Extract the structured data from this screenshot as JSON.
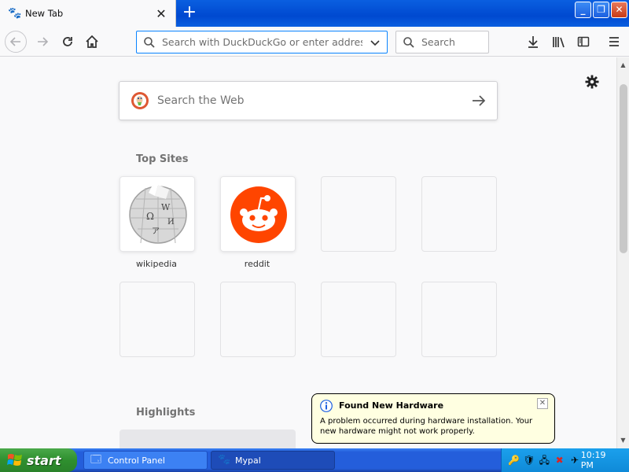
{
  "tab": {
    "title": "New Tab",
    "close_glyph": "✕",
    "favicon_icon": "mypal-icon"
  },
  "tabstrip": {
    "new_tab_glyph": "+"
  },
  "window_controls": {
    "minimize": "_",
    "maximize": "❐",
    "close": "✕"
  },
  "toolbar": {
    "url_placeholder": "Search with DuckDuckGo or enter address",
    "search_placeholder": "Search"
  },
  "newtab": {
    "search_placeholder": "Search the Web",
    "top_sites_title": "Top Sites",
    "highlights_title": "Highlights",
    "sites": [
      {
        "label": "wikipedia",
        "icon": "wikipedia-icon"
      },
      {
        "label": "reddit",
        "icon": "reddit-icon"
      }
    ]
  },
  "balloon": {
    "title": "Found New Hardware",
    "message": "A problem occurred during hardware installation. Your new hardware might not work properly.",
    "close_glyph": "✕"
  },
  "taskbar": {
    "start_label": "start",
    "tasks": [
      {
        "label": "Control Panel",
        "icon": "control-panel-icon"
      },
      {
        "label": "Mypal",
        "icon": "mypal-icon"
      }
    ],
    "clock": "10:19 PM"
  },
  "colors": {
    "accent": "#0a84ff",
    "titlebar": "#0a5fe0",
    "taskbar": "#245edb",
    "start": "#2f8f2f",
    "reddit": "#ff4500",
    "ddg": "#de5833"
  }
}
